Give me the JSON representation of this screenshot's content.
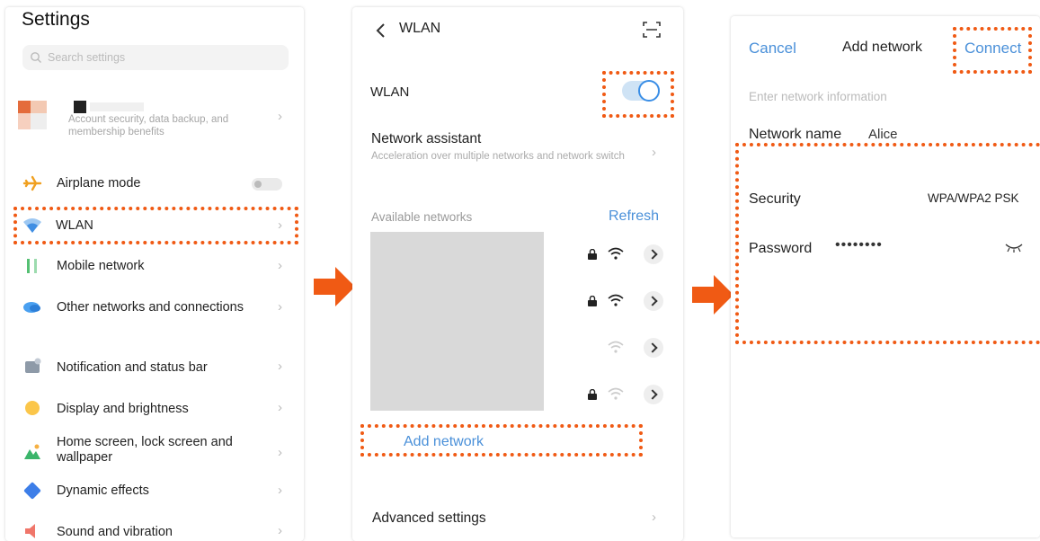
{
  "settings": {
    "title": "Settings",
    "search_placeholder": "Search settings",
    "account_description": "Account security, data backup, and membership benefits",
    "items": [
      {
        "label": "Airplane mode",
        "icon": "airplane-icon"
      },
      {
        "label": "WLAN",
        "icon": "wifi-icon"
      },
      {
        "label": "Mobile network",
        "icon": "mobile-network-icon"
      },
      {
        "label": "Other networks and connections",
        "icon": "connections-icon"
      },
      {
        "label": "Notification and status bar",
        "icon": "notification-icon"
      },
      {
        "label": "Display and brightness",
        "icon": "brightness-icon"
      },
      {
        "label": "Home screen, lock screen and wallpaper",
        "icon": "wallpaper-icon"
      },
      {
        "label": "Dynamic effects",
        "icon": "dynamic-effects-icon"
      },
      {
        "label": "Sound and vibration",
        "icon": "sound-icon"
      }
    ]
  },
  "wlan": {
    "title": "WLAN",
    "toggle_label": "WLAN",
    "toggle_on": true,
    "assistant_title": "Network assistant",
    "assistant_description": "Acceleration over multiple networks and network switch",
    "available_label": "Available networks",
    "refresh_label": "Refresh",
    "add_network_label": "Add network",
    "advanced_label": "Advanced settings",
    "networks": [
      {
        "locked": true,
        "signal": "strong"
      },
      {
        "locked": true,
        "signal": "strong"
      },
      {
        "locked": false,
        "signal": "weak"
      },
      {
        "locked": true,
        "signal": "weak"
      }
    ]
  },
  "add_network": {
    "cancel_label": "Cancel",
    "title": "Add network",
    "connect_label": "Connect",
    "hint": "Enter network information",
    "network_name_label": "Network name",
    "network_name_value": "Alice",
    "security_label": "Security",
    "security_value": "WPA/WPA2 PSK",
    "password_label": "Password",
    "password_value": "••••••••"
  },
  "colors": {
    "accent": "#4a90d9",
    "highlight": "#f05a14",
    "arrow": "#f05a14"
  }
}
